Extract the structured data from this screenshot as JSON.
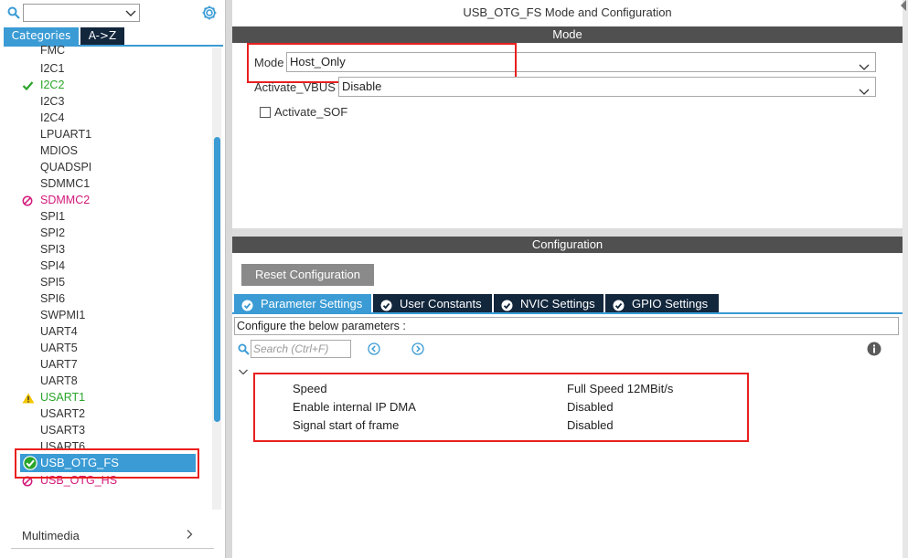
{
  "left_panel": {
    "search": {
      "value": ""
    },
    "tabs": {
      "categories": "Categories",
      "az": "A->Z"
    },
    "ip_items": [
      {
        "name": "FMC",
        "status": "none"
      },
      {
        "name": "I2C1",
        "status": "none"
      },
      {
        "name": "I2C2",
        "status": "ok"
      },
      {
        "name": "I2C3",
        "status": "none"
      },
      {
        "name": "I2C4",
        "status": "none"
      },
      {
        "name": "LPUART1",
        "status": "none"
      },
      {
        "name": "MDIOS",
        "status": "none"
      },
      {
        "name": "QUADSPI",
        "status": "none"
      },
      {
        "name": "SDMMC1",
        "status": "none"
      },
      {
        "name": "SDMMC2",
        "status": "disabled"
      },
      {
        "name": "SPI1",
        "status": "none"
      },
      {
        "name": "SPI2",
        "status": "none"
      },
      {
        "name": "SPI3",
        "status": "none"
      },
      {
        "name": "SPI4",
        "status": "none"
      },
      {
        "name": "SPI5",
        "status": "none"
      },
      {
        "name": "SPI6",
        "status": "none"
      },
      {
        "name": "SWPMI1",
        "status": "none"
      },
      {
        "name": "UART4",
        "status": "none"
      },
      {
        "name": "UART5",
        "status": "none"
      },
      {
        "name": "UART7",
        "status": "none"
      },
      {
        "name": "UART8",
        "status": "none"
      },
      {
        "name": "USART1",
        "status": "warning"
      },
      {
        "name": "USART2",
        "status": "none"
      },
      {
        "name": "USART3",
        "status": "none"
      },
      {
        "name": "USART6",
        "status": "none"
      },
      {
        "name": "USB_OTG_FS",
        "status": "ok",
        "selected": true
      },
      {
        "name": "USB_OTG_HS",
        "status": "disabled"
      }
    ],
    "multimedia": "Multimedia"
  },
  "right_panel": {
    "title": "USB_OTG_FS Mode and Configuration",
    "mode_section": {
      "header": "Mode",
      "mode_label": "Mode",
      "mode_value": "Host_Only",
      "vbus_label": "Activate_VBUS",
      "vbus_value": "Disable",
      "sof_label": "Activate_SOF",
      "sof_checked": false
    },
    "config_section": {
      "header": "Configuration",
      "reset_button": "Reset Configuration",
      "tabs": [
        {
          "label": "Parameter Settings",
          "active": true
        },
        {
          "label": "User Constants",
          "active": false
        },
        {
          "label": "NVIC Settings",
          "active": false
        },
        {
          "label": "GPIO Settings",
          "active": false
        }
      ],
      "hint": "Configure the below parameters :",
      "search_placeholder": "Search (Ctrl+F)",
      "parameters": [
        {
          "name": "Speed",
          "value": "Full Speed 12MBit/s"
        },
        {
          "name": "Enable internal IP DMA",
          "value": "Disabled"
        },
        {
          "name": "Signal start of frame",
          "value": "Disabled"
        }
      ]
    }
  },
  "colors": {
    "accent_blue": "#3a9bd5",
    "dark_navy": "#12263c",
    "header_gray": "#505050",
    "ok_green": "#2aa52a",
    "disabled_magenta": "#d4197a",
    "warning_yellow": "#f2c500",
    "highlight_red": "#e8201e"
  }
}
